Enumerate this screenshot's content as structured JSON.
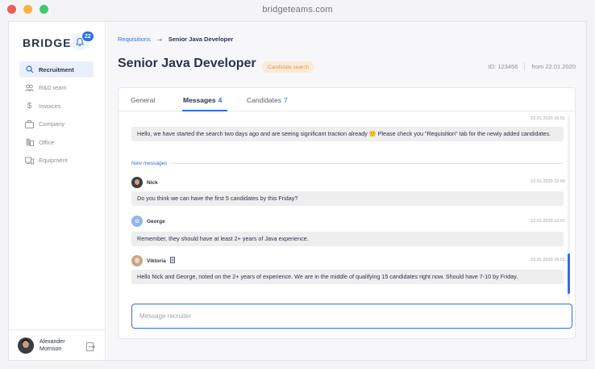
{
  "browser": {
    "url": "bridgeteams.com",
    "dots": [
      "#ee5c57",
      "#f5b440",
      "#3ccb6d"
    ]
  },
  "sidebar": {
    "logo": "BRIDGE",
    "notifications": "22",
    "items": [
      {
        "label": "Recruitment",
        "icon": "search-icon",
        "active": true
      },
      {
        "label": "R&D team",
        "icon": "team-icon",
        "active": false
      },
      {
        "label": "Invoices",
        "icon": "dollar-icon",
        "active": false
      },
      {
        "label": "Company",
        "icon": "briefcase-icon",
        "active": false
      },
      {
        "label": "Office",
        "icon": "building-icon",
        "active": false
      },
      {
        "label": "Equipment",
        "icon": "devices-icon",
        "active": false
      }
    ],
    "user": {
      "first": "Alexander",
      "last": "Morrison"
    }
  },
  "header": {
    "breadcrumb_link": "Requisitions",
    "breadcrumb_arrow": "→",
    "breadcrumb_current": "Senior Java Developer",
    "title": "Senior Java Developer",
    "status": "Candidate search",
    "id": "ID: 123456",
    "date": "from 22.01.2020"
  },
  "tabs": [
    {
      "label": "General",
      "count": ""
    },
    {
      "label": "Messages",
      "count": "4"
    },
    {
      "label": "Candidates",
      "count": "7"
    }
  ],
  "messages": {
    "first": {
      "time": "22.01.2020  16:51",
      "text": "Hello, we have started the search two days ago and are seeing significant traction already 🙂 Please check you \"Requisition\" tab for the newly added candidates."
    },
    "divider": "New messages",
    "items": [
      {
        "sender": "Nick",
        "initial": "",
        "time": "22.01.2020  12:00",
        "text": "Do you think we can have the first 5 candidates by this Friday?"
      },
      {
        "sender": "George",
        "initial": "G",
        "time": "22.01.2020  12:07",
        "text": "Remember, they should have at least 2+ years of Java experience."
      },
      {
        "sender": "Viktoria",
        "initial": "",
        "time": "22.01.2020  16:51",
        "text": "Hello Nick and George, noted on the 2+ years of experience. We are in the middle of qualifying 15 candidates right now. Should have 7-10 by Friday."
      }
    ]
  },
  "compose": {
    "placeholder": "Message recruiter"
  },
  "colors": {
    "accent": "#2f6fdc",
    "status_bg": "#fcebd9",
    "status_text": "#e59140"
  }
}
